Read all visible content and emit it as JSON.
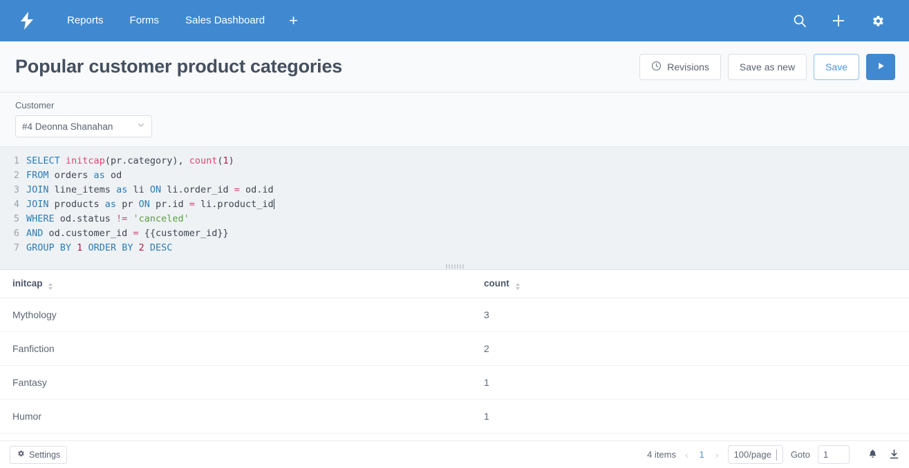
{
  "nav": {
    "logo_icon": "lightning-bolt-icon",
    "links": [
      {
        "label": "Reports"
      },
      {
        "label": "Forms"
      },
      {
        "label": "Sales Dashboard"
      }
    ],
    "add_tab_label": "+",
    "icons": [
      {
        "name": "search-icon"
      },
      {
        "name": "plus-icon"
      },
      {
        "name": "gear-icon"
      }
    ]
  },
  "header": {
    "title": "Popular customer product categories",
    "revisions_label": "Revisions",
    "revisions_icon": "clock-icon",
    "save_as_new_label": "Save as new",
    "save_label": "Save",
    "run_icon": "play-icon"
  },
  "filters": {
    "customer": {
      "label": "Customer",
      "value": "#4 Deonna Shanahan",
      "chevron_icon": "chevron-down-icon"
    }
  },
  "editor": {
    "language": "sql",
    "lines": [
      {
        "n": "1",
        "tokens": [
          {
            "t": "SELECT",
            "c": "kw"
          },
          {
            "t": " ",
            "c": ""
          },
          {
            "t": "initcap",
            "c": "fn"
          },
          {
            "t": "(pr.category), ",
            "c": ""
          },
          {
            "t": "count",
            "c": "fn"
          },
          {
            "t": "(",
            "c": ""
          },
          {
            "t": "1",
            "c": "num"
          },
          {
            "t": ")",
            "c": ""
          }
        ]
      },
      {
        "n": "2",
        "tokens": [
          {
            "t": "FROM",
            "c": "kw"
          },
          {
            "t": " orders ",
            "c": ""
          },
          {
            "t": "as",
            "c": "kw"
          },
          {
            "t": " od",
            "c": ""
          }
        ]
      },
      {
        "n": "3",
        "tokens": [
          {
            "t": "JOIN",
            "c": "kw"
          },
          {
            "t": " line_items ",
            "c": ""
          },
          {
            "t": "as",
            "c": "kw"
          },
          {
            "t": " li ",
            "c": ""
          },
          {
            "t": "ON",
            "c": "kw"
          },
          {
            "t": " li.order_id ",
            "c": ""
          },
          {
            "t": "=",
            "c": "op"
          },
          {
            "t": " od.id",
            "c": ""
          }
        ]
      },
      {
        "n": "4",
        "tokens": [
          {
            "t": "JOIN",
            "c": "kw"
          },
          {
            "t": " products ",
            "c": ""
          },
          {
            "t": "as",
            "c": "kw"
          },
          {
            "t": " pr ",
            "c": ""
          },
          {
            "t": "ON",
            "c": "kw"
          },
          {
            "t": " pr.id ",
            "c": ""
          },
          {
            "t": "=",
            "c": "op"
          },
          {
            "t": " li.product_id",
            "c": ""
          }
        ],
        "caret": true
      },
      {
        "n": "5",
        "tokens": [
          {
            "t": "WHERE",
            "c": "kw"
          },
          {
            "t": " od.status ",
            "c": ""
          },
          {
            "t": "!=",
            "c": "op"
          },
          {
            "t": " ",
            "c": ""
          },
          {
            "t": "'canceled'",
            "c": "str"
          }
        ]
      },
      {
        "n": "6",
        "tokens": [
          {
            "t": "AND",
            "c": "kw"
          },
          {
            "t": " od.customer_id ",
            "c": ""
          },
          {
            "t": "=",
            "c": "op"
          },
          {
            "t": " {{customer_id}}",
            "c": ""
          }
        ]
      },
      {
        "n": "7",
        "tokens": [
          {
            "t": "GROUP BY",
            "c": "kw"
          },
          {
            "t": " ",
            "c": ""
          },
          {
            "t": "1",
            "c": "num"
          },
          {
            "t": " ",
            "c": ""
          },
          {
            "t": "ORDER BY",
            "c": "kw"
          },
          {
            "t": " ",
            "c": ""
          },
          {
            "t": "2",
            "c": "num"
          },
          {
            "t": " ",
            "c": ""
          },
          {
            "t": "DESC",
            "c": "kw"
          }
        ]
      }
    ]
  },
  "results": {
    "columns": [
      {
        "label": "initcap",
        "sortable": true
      },
      {
        "label": "count",
        "sortable": true
      }
    ],
    "rows": [
      {
        "initcap": "Mythology",
        "count": "3"
      },
      {
        "initcap": "Fanfiction",
        "count": "2"
      },
      {
        "initcap": "Fantasy",
        "count": "1"
      },
      {
        "initcap": "Humor",
        "count": "1"
      }
    ]
  },
  "footer": {
    "settings_label": "Settings",
    "settings_icon": "gear-icon",
    "item_count": "4 items",
    "prev_icon": "chevron-left-icon",
    "current_page": "1",
    "next_icon": "chevron-right-icon",
    "page_size": "100/page",
    "goto_label": "Goto",
    "goto_value": "1",
    "icons": [
      {
        "name": "bell-icon"
      },
      {
        "name": "download-icon"
      }
    ]
  },
  "colors": {
    "nav_blue": "#4089d0",
    "accent_blue": "#4a94dd",
    "editor_bg": "#eef2f5",
    "keyword": "#2b7cb8",
    "function": "#e2436f",
    "string": "#5a9e3e",
    "number": "#b01b45"
  }
}
